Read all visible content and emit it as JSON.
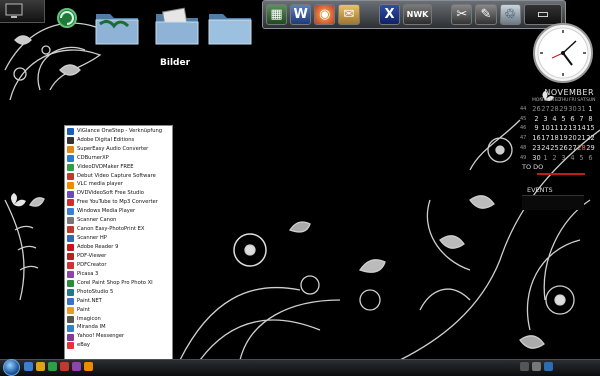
{
  "desktop": {
    "folder_label": "Bilder"
  },
  "top_dock": {
    "icons": [
      "excel-icon",
      "word-icon",
      "firefox-icon",
      "mail-icon",
      "x-icon",
      "nwk-icon",
      "tools-icon",
      "recycle-icon",
      "window-icon"
    ],
    "nwk_label": "NWK"
  },
  "calendar": {
    "month": "NOVEMBER",
    "weekdays": [
      "MON",
      "TUE",
      "WED",
      "THU",
      "FRI",
      "SAT",
      "SUN"
    ],
    "weeks": [
      {
        "wk": "44",
        "days": [
          "26",
          "27",
          "28",
          "29",
          "30",
          "31",
          "1"
        ]
      },
      {
        "wk": "45",
        "days": [
          "2",
          "3",
          "4",
          "5",
          "6",
          "7",
          "8"
        ]
      },
      {
        "wk": "46",
        "days": [
          "9",
          "10",
          "11",
          "12",
          "13",
          "14",
          "15"
        ]
      },
      {
        "wk": "47",
        "days": [
          "16",
          "17",
          "18",
          "19",
          "20",
          "21",
          "22"
        ]
      },
      {
        "wk": "48",
        "days": [
          "23",
          "24",
          "25",
          "26",
          "27",
          "28",
          "29"
        ]
      },
      {
        "wk": "49",
        "days": [
          "30",
          "1",
          "2",
          "3",
          "4",
          "5",
          "6"
        ]
      }
    ],
    "todo_label": "TO DO",
    "events_label": "EVENTS"
  },
  "start_menu": {
    "items": [
      {
        "label": "ViGlance OneStep - Verknüpfung",
        "color": "#1c5fb8"
      },
      {
        "label": "Adobe Digital Editions",
        "color": "#333333"
      },
      {
        "label": "SuperEasy Audio Converter",
        "color": "#e08a1a"
      },
      {
        "label": "CDBurnerXP",
        "color": "#2a7ad8"
      },
      {
        "label": "VideoDVDMaker FREE",
        "color": "#2f9e44"
      },
      {
        "label": "Debut Video Capture Software",
        "color": "#c0392b"
      },
      {
        "label": "VLC media player",
        "color": "#f08a00"
      },
      {
        "label": "DVDVideoSoft Free Studio",
        "color": "#6a4bb8"
      },
      {
        "label": "Free YouTube to Mp3 Converter",
        "color": "#d12c2c"
      },
      {
        "label": "Windows Media Player",
        "color": "#3a7fd5"
      },
      {
        "label": "Scanner Canon",
        "color": "#777777"
      },
      {
        "label": "Canon Easy-PhotoPrint EX",
        "color": "#c0392b"
      },
      {
        "label": "Scanner HP",
        "color": "#2a6db5"
      },
      {
        "label": "Adobe Reader 9",
        "color": "#c4161c"
      },
      {
        "label": "PDF-Viewer",
        "color": "#b22222"
      },
      {
        "label": "PDFCreator",
        "color": "#cc3333"
      },
      {
        "label": "Picasa 3",
        "color": "#8e44ad"
      },
      {
        "label": "Corel Paint Shop Pro Photo XI",
        "color": "#2b8a3e"
      },
      {
        "label": "PhotoStudio 5",
        "color": "#1f7a8c"
      },
      {
        "label": "Paint.NET",
        "color": "#3b6fd1"
      },
      {
        "label": "Paint",
        "color": "#e0a020"
      },
      {
        "label": "Imagicon",
        "color": "#555555"
      },
      {
        "label": "Miranda IM",
        "color": "#2e86c1"
      },
      {
        "label": "Yahoo! Messenger",
        "color": "#7d3c98"
      },
      {
        "label": "eBay",
        "color": "#e53238"
      }
    ]
  },
  "colors": {
    "accent_red": "#c51a1a",
    "menu_bg": "#ffffff",
    "desktop_bg": "#000000"
  }
}
